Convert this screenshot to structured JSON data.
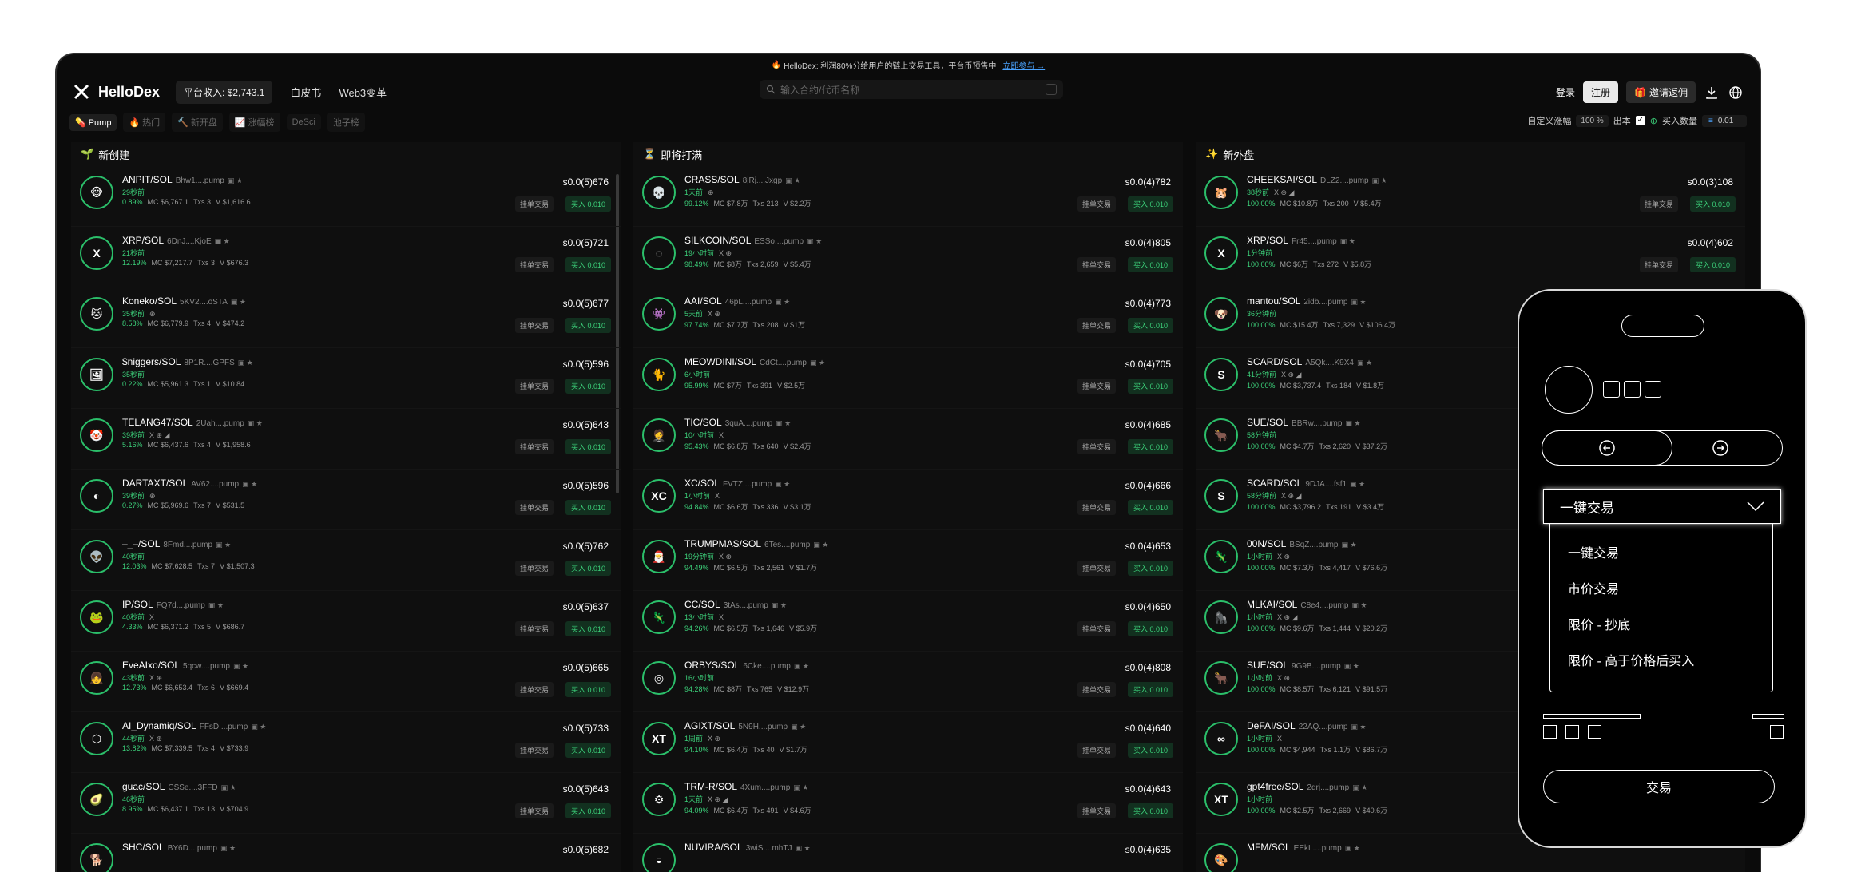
{
  "announcement": {
    "text": "HelloDex: 利润80%分给用户的链上交易工具，平台币预售中",
    "link": "立即参与 →"
  },
  "header": {
    "brand": "HelloDex",
    "revenue": "平台收入: $2,743.1",
    "nav": [
      "白皮书",
      "Web3变革"
    ],
    "search_placeholder": "输入合约/代币名称",
    "login": "登录",
    "register": "注册",
    "invite": "邀请返佣"
  },
  "filters": {
    "tabs": [
      {
        "icon": "💊",
        "label": "Pump",
        "active": true
      },
      {
        "icon": "🔥",
        "label": "热门",
        "active": false
      },
      {
        "icon": "🔨",
        "label": "新开盘",
        "active": false
      },
      {
        "icon": "📈",
        "label": "涨幅榜",
        "active": false
      },
      {
        "icon": "",
        "label": "DeSci",
        "active": false
      },
      {
        "icon": "",
        "label": "池子榜",
        "active": false
      }
    ],
    "custom_change_label": "自定义涨幅",
    "custom_change_value": "100",
    "custom_change_unit": "%",
    "output_label": "出本",
    "buy_qty_label": "买入数量",
    "buy_qty_value": "0.01"
  },
  "columns": [
    {
      "icon": "🌱",
      "title": "新创建",
      "rows": [
        {
          "name": "ANPIT/SOL",
          "addr": "Bhw1....pump",
          "age": "29秒前",
          "social": "",
          "pct": "0.89%",
          "mc": "MC $6,767.1",
          "txs": "Txs 3",
          "vol": "V $1,616.6",
          "price": "s0.0(5)676",
          "avatar": "🐵",
          "limit": "挂单交易",
          "buy": "买入 0.010"
        },
        {
          "name": "XRP/SOL",
          "addr": "6DnJ....KjoE",
          "age": "21秒前",
          "social": "",
          "pct": "12.19%",
          "mc": "MC $7,217.7",
          "txs": "Txs 3",
          "vol": "V $676.3",
          "price": "s0.0(5)721",
          "avatar": "X",
          "limit": "挂单交易",
          "buy": "买入 0.010"
        },
        {
          "name": "Koneko/SOL",
          "addr": "5KV2....oSTA",
          "age": "35秒前",
          "social": "⊕",
          "pct": "8.58%",
          "mc": "MC $6,779.9",
          "txs": "Txs 4",
          "vol": "V $474.2",
          "price": "s0.0(5)677",
          "avatar": "🐱",
          "limit": "挂单交易",
          "buy": "买入 0.010"
        },
        {
          "name": "$niggers/SOL",
          "addr": "8P1R....GPFS",
          "age": "35秒前",
          "social": "",
          "pct": "0.22%",
          "mc": "MC $5,961.3",
          "txs": "Txs 1",
          "vol": "V $10.84",
          "price": "s0.0(5)596",
          "avatar": "🖼",
          "limit": "挂单交易",
          "buy": "买入 0.010"
        },
        {
          "name": "TELANG47/SOL",
          "addr": "2Uah....pump",
          "age": "39秒前",
          "social": "X ⊕ ◢",
          "pct": "5.16%",
          "mc": "MC $6,437.6",
          "txs": "Txs 4",
          "vol": "V $1,958.6",
          "price": "s0.0(5)643",
          "avatar": "🤡",
          "limit": "挂单交易",
          "buy": "买入 0.010"
        },
        {
          "name": "DARTAXT/SOL",
          "addr": "AV62....pump",
          "age": "39秒前",
          "social": "⊕",
          "pct": "0.27%",
          "mc": "MC $5,969.6",
          "txs": "Txs 7",
          "vol": "V $531.5",
          "price": "s0.0(5)596",
          "avatar": "◐",
          "limit": "挂单交易",
          "buy": "买入 0.010"
        },
        {
          "name": "–_–/SOL",
          "addr": "8Fmd....pump",
          "age": "40秒前",
          "social": "",
          "pct": "12.03%",
          "mc": "MC $7,628.5",
          "txs": "Txs 7",
          "vol": "V $1,507.3",
          "price": "s0.0(5)762",
          "avatar": "👽",
          "limit": "挂单交易",
          "buy": "买入 0.010"
        },
        {
          "name": "IP/SOL",
          "addr": "FQ7d....pump",
          "age": "40秒前",
          "social": "X",
          "pct": "4.33%",
          "mc": "MC $6,371.2",
          "txs": "Txs 5",
          "vol": "V $686.7",
          "price": "s0.0(5)637",
          "avatar": "🐸",
          "limit": "挂单交易",
          "buy": "买入 0.010"
        },
        {
          "name": "EveAIxo/SOL",
          "addr": "5qcw....pump",
          "age": "43秒前",
          "social": "X ⊕",
          "pct": "12.73%",
          "mc": "MC $6,653.4",
          "txs": "Txs 6",
          "vol": "V $669.4",
          "price": "s0.0(5)665",
          "avatar": "👧",
          "limit": "挂单交易",
          "buy": "买入 0.010"
        },
        {
          "name": "AI_Dynamiq/SOL",
          "addr": "FFsD....pump",
          "age": "44秒前",
          "social": "X ⊕",
          "pct": "13.82%",
          "mc": "MC $7,339.5",
          "txs": "Txs 4",
          "vol": "V $733.9",
          "price": "s0.0(5)733",
          "avatar": "⬡",
          "limit": "挂单交易",
          "buy": "买入 0.010"
        },
        {
          "name": "guac/SOL",
          "addr": "CSSe....3FFD",
          "age": "46秒前",
          "social": "",
          "pct": "8.95%",
          "mc": "MC $6,437.1",
          "txs": "Txs 13",
          "vol": "V $704.9",
          "price": "s0.0(5)643",
          "avatar": "🥑",
          "limit": "挂单交易",
          "buy": "买入 0.010"
        },
        {
          "name": "SHC/SOL",
          "addr": "BY6D....pump",
          "age": "",
          "social": "",
          "pct": "",
          "mc": "",
          "txs": "",
          "vol": "",
          "price": "s0.0(5)682",
          "avatar": "🐕",
          "limit": "",
          "buy": ""
        }
      ]
    },
    {
      "icon": "⏳",
      "title": "即将打满",
      "rows": [
        {
          "name": "CRASS/SOL",
          "addr": "8jRj....Jxgp",
          "age": "1天前",
          "social": "⊕",
          "pct": "99.12%",
          "mc": "MC $7.8万",
          "txs": "Txs 213",
          "vol": "V $2.2万",
          "price": "s0.0(4)782",
          "avatar": "💀",
          "limit": "挂单交易",
          "buy": "买入 0.010"
        },
        {
          "name": "SILKCOIN/SOL",
          "addr": "ESSo....pump",
          "age": "19小时前",
          "social": "X ⊕",
          "pct": "98.49%",
          "mc": "MC $8万",
          "txs": "Txs 2,659",
          "vol": "V $5.4万",
          "price": "s0.0(4)805",
          "avatar": "◌",
          "limit": "挂单交易",
          "buy": "买入 0.010"
        },
        {
          "name": "AAI/SOL",
          "addr": "46pL....pump",
          "age": "5天前",
          "social": "X ⊕",
          "pct": "97.74%",
          "mc": "MC $7.7万",
          "txs": "Txs 208",
          "vol": "V $1万",
          "price": "s0.0(4)773",
          "avatar": "👾",
          "limit": "挂单交易",
          "buy": "买入 0.010"
        },
        {
          "name": "MEOWDINI/SOL",
          "addr": "CdCt....pump",
          "age": "6小时前",
          "social": "",
          "pct": "95.99%",
          "mc": "MC $7万",
          "txs": "Txs 391",
          "vol": "V $2.5万",
          "price": "s0.0(4)705",
          "avatar": "🐈",
          "limit": "挂单交易",
          "buy": "买入 0.010"
        },
        {
          "name": "TIC/SOL",
          "addr": "3quA....pump",
          "age": "10小时前",
          "social": "X",
          "pct": "95.43%",
          "mc": "MC $6.8万",
          "txs": "Txs 640",
          "vol": "V $2.4万",
          "price": "s0.0(4)685",
          "avatar": "🤵",
          "limit": "挂单交易",
          "buy": "买入 0.010"
        },
        {
          "name": "XC/SOL",
          "addr": "FVTZ....pump",
          "age": "1小时前",
          "social": "X",
          "pct": "94.84%",
          "mc": "MC $6.6万",
          "txs": "Txs 336",
          "vol": "V $3.1万",
          "price": "s0.0(4)666",
          "avatar": "XC",
          "limit": "挂单交易",
          "buy": "买入 0.010"
        },
        {
          "name": "TRUMPMAS/SOL",
          "addr": "6Tes....pump",
          "age": "19分钟前",
          "social": "X ⊕",
          "pct": "94.49%",
          "mc": "MC $6.5万",
          "txs": "Txs 2,561",
          "vol": "V $1.7万",
          "price": "s0.0(4)653",
          "avatar": "🎅",
          "limit": "挂单交易",
          "buy": "买入 0.010"
        },
        {
          "name": "CC/SOL",
          "addr": "3tAs....pump",
          "age": "13小时前",
          "social": "X",
          "pct": "94.26%",
          "mc": "MC $6.5万",
          "txs": "Txs 1,646",
          "vol": "V $5.9万",
          "price": "s0.0(4)650",
          "avatar": "🦎",
          "limit": "挂单交易",
          "buy": "买入 0.010"
        },
        {
          "name": "ORBYS/SOL",
          "addr": "6Cke....pump",
          "age": "16小时前",
          "social": "",
          "pct": "94.28%",
          "mc": "MC $8万",
          "txs": "Txs 765",
          "vol": "V $12.9万",
          "price": "s0.0(4)808",
          "avatar": "◎",
          "limit": "挂单交易",
          "buy": "买入 0.010"
        },
        {
          "name": "AGIXT/SOL",
          "addr": "5N9H....pump",
          "age": "1周前",
          "social": "X ⊕",
          "pct": "94.10%",
          "mc": "MC $6.4万",
          "txs": "Txs 40",
          "vol": "V $1.7万",
          "price": "s0.0(4)640",
          "avatar": "XT",
          "limit": "挂单交易",
          "buy": "买入 0.010"
        },
        {
          "name": "TRM-R/SOL",
          "addr": "4Xum....pump",
          "age": "1天前",
          "social": "X ⊕ ◢",
          "pct": "94.09%",
          "mc": "MC $6.4万",
          "txs": "Txs 491",
          "vol": "V $4.6万",
          "price": "s0.0(4)643",
          "avatar": "⚙",
          "limit": "挂单交易",
          "buy": "买入 0.010"
        },
        {
          "name": "NUVIRA/SOL",
          "addr": "3wiS....mhTJ",
          "age": "",
          "social": "",
          "pct": "",
          "mc": "",
          "txs": "",
          "vol": "",
          "price": "s0.0(4)635",
          "avatar": "◒",
          "limit": "",
          "buy": ""
        }
      ]
    },
    {
      "icon": "✨",
      "title": "新外盘",
      "rows": [
        {
          "name": "CHEEKSAI/SOL",
          "addr": "DLZ2....pump",
          "age": "38秒前",
          "social": "X ⊕ ◢",
          "pct": "100.00%",
          "mc": "MC $10.8万",
          "txs": "Txs 200",
          "vol": "V $5.4万",
          "price": "s0.0(3)108",
          "avatar": "🐹",
          "limit": "挂单交易",
          "buy": "买入 0.010"
        },
        {
          "name": "XRP/SOL",
          "addr": "Fr45....pump",
          "age": "1分钟前",
          "social": "",
          "pct": "100.00%",
          "mc": "MC $6万",
          "txs": "Txs 272",
          "vol": "V $5.8万",
          "price": "s0.0(4)602",
          "avatar": "X",
          "limit": "挂单交易",
          "buy": "买入 0.010"
        },
        {
          "name": "mantou/SOL",
          "addr": "2idb....pump",
          "age": "36分钟前",
          "social": "",
          "pct": "100.00%",
          "mc": "MC $15.4万",
          "txs": "Txs 7,329",
          "vol": "V $106.4万",
          "price": "",
          "avatar": "🐶",
          "limit": "",
          "buy": ""
        },
        {
          "name": "SCARD/SOL",
          "addr": "A5Qk....K9X4",
          "age": "41分钟前",
          "social": "X ⊕ ◢",
          "pct": "100.00%",
          "mc": "MC $3,737.4",
          "txs": "Txs 184",
          "vol": "V $1.8万",
          "price": "",
          "avatar": "S",
          "limit": "",
          "buy": ""
        },
        {
          "name": "SUE/SOL",
          "addr": "BBRw....pump",
          "age": "58分钟前",
          "social": "",
          "pct": "100.00%",
          "mc": "MC $4.7万",
          "txs": "Txs 2,620",
          "vol": "V $37.2万",
          "price": "",
          "avatar": "🐂",
          "limit": "",
          "buy": ""
        },
        {
          "name": "SCARD/SOL",
          "addr": "9DJA....fsf1",
          "age": "58分钟前",
          "social": "X ⊕ ◢",
          "pct": "100.00%",
          "mc": "MC $3,796.2",
          "txs": "Txs 191",
          "vol": "V $3.4万",
          "price": "",
          "avatar": "S",
          "limit": "",
          "buy": ""
        },
        {
          "name": "00N/SOL",
          "addr": "BSqZ....pump",
          "age": "1小时前",
          "social": "X ⊕",
          "pct": "100.00%",
          "mc": "MC $7.3万",
          "txs": "Txs 4,417",
          "vol": "V $76.6万",
          "price": "",
          "avatar": "🦎",
          "limit": "",
          "buy": ""
        },
        {
          "name": "MLKAI/SOL",
          "addr": "C8e4....pump",
          "age": "1小时前",
          "social": "X ⊕ ◢",
          "pct": "100.00%",
          "mc": "MC $9.6万",
          "txs": "Txs 1,444",
          "vol": "V $20.2万",
          "price": "",
          "avatar": "🦍",
          "limit": "",
          "buy": ""
        },
        {
          "name": "SUE/SOL",
          "addr": "9G9B....pump",
          "age": "1小时前",
          "social": "X ⊕",
          "pct": "100.00%",
          "mc": "MC $8.5万",
          "txs": "Txs 6,121",
          "vol": "V $91.5万",
          "price": "",
          "avatar": "🐂",
          "limit": "",
          "buy": ""
        },
        {
          "name": "DeFAI/SOL",
          "addr": "22AQ....pump",
          "age": "1小时前",
          "social": "X",
          "pct": "100.00%",
          "mc": "MC $4,944",
          "txs": "Txs 1.1万",
          "vol": "V $86.7万",
          "price": "",
          "avatar": "∞",
          "limit": "",
          "buy": ""
        },
        {
          "name": "gpt4free/SOL",
          "addr": "2drj....pump",
          "age": "1小时前",
          "social": "",
          "pct": "100.00%",
          "mc": "MC $2.5万",
          "txs": "Txs 2,669",
          "vol": "V $40.6万",
          "price": "",
          "avatar": "XT",
          "limit": "",
          "buy": ""
        },
        {
          "name": "MFM/SOL",
          "addr": "EEkL....pump",
          "age": "",
          "social": "",
          "pct": "",
          "mc": "",
          "txs": "",
          "vol": "",
          "price": "",
          "avatar": "🎨",
          "limit": "",
          "buy": ""
        }
      ]
    }
  ],
  "phone": {
    "select_value": "一键交易",
    "options": [
      "一键交易",
      "市价交易",
      "限价 - 抄底",
      "限价 - 高于价格后买入"
    ],
    "trade_button": "交易"
  },
  "colors": {
    "accent_green": "#3cd07a",
    "background": "#0b0b0b",
    "invite_icon": "#ff5a2a"
  }
}
